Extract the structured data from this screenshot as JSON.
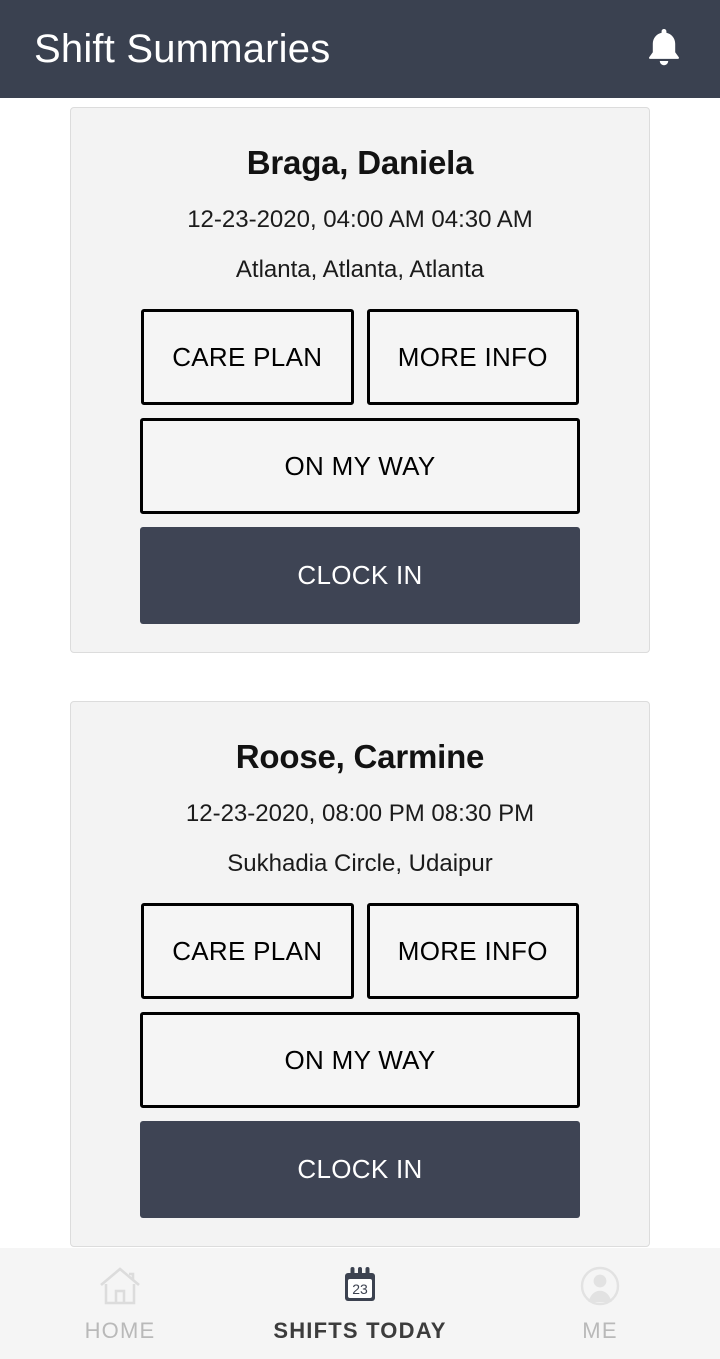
{
  "header": {
    "title": "Shift Summaries",
    "notification_icon": "bell-icon",
    "background_color": "#3a4150",
    "text_color": "#ffffff"
  },
  "shifts": [
    {
      "client_name": "Braga, Daniela",
      "time": "12-23-2020, 04:00 AM 04:30 AM",
      "location": "Atlanta, Atlanta, Atlanta",
      "care_plan_label": "CARE PLAN",
      "more_info_label": "MORE INFO",
      "on_my_way_label": "ON MY WAY",
      "clock_in_label": "CLOCK IN"
    },
    {
      "client_name": "Roose, Carmine",
      "time": "12-23-2020, 08:00 PM 08:30 PM",
      "location": "Sukhadia Circle, Udaipur",
      "care_plan_label": "CARE PLAN",
      "more_info_label": "MORE INFO",
      "on_my_way_label": "ON MY WAY",
      "clock_in_label": "CLOCK IN"
    }
  ],
  "bottom_nav": {
    "items": [
      {
        "label": "HOME",
        "icon": "home-icon",
        "active": false
      },
      {
        "label": "SHIFTS TODAY",
        "icon": "calendar-icon",
        "active": true,
        "calendar_day": "23"
      },
      {
        "label": "ME",
        "icon": "person-avatar-icon",
        "active": false
      }
    ]
  },
  "colors": {
    "primary": "#3e4454",
    "card_background": "#f3f3f3",
    "page_background": "#ffffff",
    "nav_background": "#f5f5f5",
    "inactive_nav": "#b9b9b9",
    "active_nav": "#3c3c3c"
  }
}
